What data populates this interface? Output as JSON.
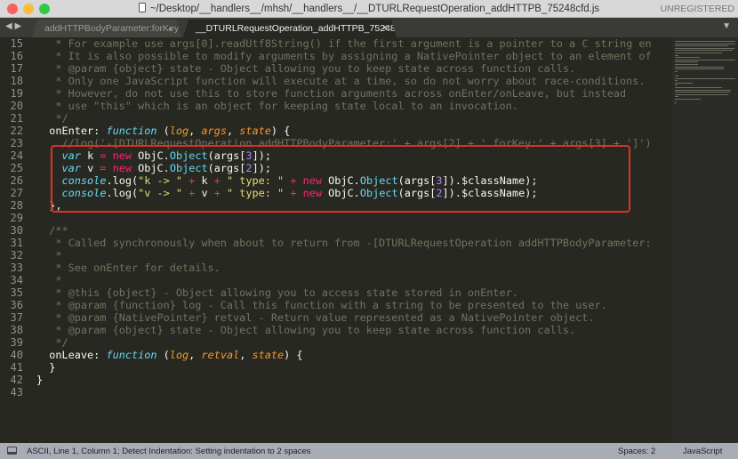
{
  "window": {
    "title": "~/Desktop/__handlers__/mhsh/__handlers__/__DTURLRequestOperation_addHTTPB_75248cfd.js",
    "unregistered": "UNREGISTERED"
  },
  "tabs": [
    {
      "label": "addHTTPBodyParameter:forKey:",
      "marker": "●"
    },
    {
      "label": "__DTURLRequestOperation_addHTTPB_75248cfd.js",
      "marker": "×"
    }
  ],
  "status": {
    "message": "ASCII, Line 1, Column 1; Detect Indentation: Setting indentation to 2 spaces",
    "spaces": "Spaces: 2",
    "syntax": "JavaScript"
  },
  "highlight_color": "#e0301e",
  "lines": [
    {
      "n": "15",
      "t": [
        [
          "c",
          "   * For example use args[0].readUtf8String() if the first argument is a pointer to a C string en"
        ]
      ]
    },
    {
      "n": "16",
      "t": [
        [
          "c",
          "   * It is also possible to modify arguments by assigning a NativePointer object to an element of"
        ]
      ]
    },
    {
      "n": "17",
      "t": [
        [
          "c",
          "   * @param {object} state - Object allowing you to keep state across function calls."
        ]
      ]
    },
    {
      "n": "18",
      "t": [
        [
          "c",
          "   * Only one JavaScript function will execute at a time, so do not worry about race-conditions."
        ]
      ]
    },
    {
      "n": "19",
      "t": [
        [
          "c",
          "   * However, do not use this to store function arguments across onEnter/onLeave, but instead"
        ]
      ]
    },
    {
      "n": "20",
      "t": [
        [
          "c",
          "   * use \"this\" which is an object for keeping state local to an invocation."
        ]
      ]
    },
    {
      "n": "21",
      "t": [
        [
          "c",
          "   */"
        ]
      ]
    },
    {
      "n": "22",
      "t": [
        [
          "d",
          "  onEnter: "
        ],
        [
          "f",
          "function"
        ],
        [
          "d",
          " ("
        ],
        [
          "p",
          "log"
        ],
        [
          "d",
          ", "
        ],
        [
          "p",
          "args"
        ],
        [
          "d",
          ", "
        ],
        [
          "p",
          "state"
        ],
        [
          "d",
          ") {"
        ]
      ]
    },
    {
      "n": "23",
      "t": [
        [
          "c",
          "    //log('-[DTURLRequestOperation addHTTPBodyParameter:' + args[2] + ' forKey:' + args[3] + ']')"
        ]
      ]
    },
    {
      "n": "24",
      "t": [
        [
          "d",
          "    "
        ],
        [
          "f",
          "var"
        ],
        [
          "d",
          " k "
        ],
        [
          "k",
          "="
        ],
        [
          "d",
          " "
        ],
        [
          "k",
          "new"
        ],
        [
          "d",
          " ObjC."
        ],
        [
          "o",
          "Object"
        ],
        [
          "d",
          "(args["
        ],
        [
          "n",
          "3"
        ],
        [
          "d",
          "]);"
        ]
      ]
    },
    {
      "n": "25",
      "t": [
        [
          "d",
          "    "
        ],
        [
          "f",
          "var"
        ],
        [
          "d",
          " v "
        ],
        [
          "k",
          "="
        ],
        [
          "d",
          " "
        ],
        [
          "k",
          "new"
        ],
        [
          "d",
          " ObjC."
        ],
        [
          "o",
          "Object"
        ],
        [
          "d",
          "(args["
        ],
        [
          "n",
          "2"
        ],
        [
          "d",
          "]);"
        ]
      ]
    },
    {
      "n": "26",
      "t": [
        [
          "d",
          "    "
        ],
        [
          "f",
          "console"
        ],
        [
          "d",
          ".log("
        ],
        [
          "s",
          "\"k -> \""
        ],
        [
          "d",
          " "
        ],
        [
          "k",
          "+"
        ],
        [
          "d",
          " k "
        ],
        [
          "k",
          "+"
        ],
        [
          "d",
          " "
        ],
        [
          "s",
          "\" type: \""
        ],
        [
          "d",
          " "
        ],
        [
          "k",
          "+"
        ],
        [
          "d",
          " "
        ],
        [
          "k",
          "new"
        ],
        [
          "d",
          " ObjC."
        ],
        [
          "o",
          "Object"
        ],
        [
          "d",
          "(args["
        ],
        [
          "n",
          "3"
        ],
        [
          "d",
          "]).$className);"
        ]
      ]
    },
    {
      "n": "27",
      "t": [
        [
          "d",
          "    "
        ],
        [
          "f",
          "console"
        ],
        [
          "d",
          ".log("
        ],
        [
          "s",
          "\"v -> \""
        ],
        [
          "d",
          " "
        ],
        [
          "k",
          "+"
        ],
        [
          "d",
          " v "
        ],
        [
          "k",
          "+"
        ],
        [
          "d",
          " "
        ],
        [
          "s",
          "\" type: \""
        ],
        [
          "d",
          " "
        ],
        [
          "k",
          "+"
        ],
        [
          "d",
          " "
        ],
        [
          "k",
          "new"
        ],
        [
          "d",
          " ObjC."
        ],
        [
          "o",
          "Object"
        ],
        [
          "d",
          "(args["
        ],
        [
          "n",
          "2"
        ],
        [
          "d",
          "]).$className);"
        ]
      ]
    },
    {
      "n": "28",
      "t": [
        [
          "d",
          "  },"
        ]
      ]
    },
    {
      "n": "29",
      "t": []
    },
    {
      "n": "30",
      "t": [
        [
          "c",
          "  /**"
        ]
      ]
    },
    {
      "n": "31",
      "t": [
        [
          "c",
          "   * Called synchronously when about to return from -[DTURLRequestOperation addHTTPBodyParameter:"
        ]
      ]
    },
    {
      "n": "32",
      "t": [
        [
          "c",
          "   *"
        ]
      ]
    },
    {
      "n": "33",
      "t": [
        [
          "c",
          "   * See onEnter for details."
        ]
      ]
    },
    {
      "n": "34",
      "t": [
        [
          "c",
          "   *"
        ]
      ]
    },
    {
      "n": "35",
      "t": [
        [
          "c",
          "   * @this {object} - Object allowing you to access state stored in onEnter."
        ]
      ]
    },
    {
      "n": "36",
      "t": [
        [
          "c",
          "   * @param {function} log - Call this function with a string to be presented to the user."
        ]
      ]
    },
    {
      "n": "37",
      "t": [
        [
          "c",
          "   * @param {NativePointer} retval - Return value represented as a NativePointer object."
        ]
      ]
    },
    {
      "n": "38",
      "t": [
        [
          "c",
          "   * @param {object} state - Object allowing you to keep state across function calls."
        ]
      ]
    },
    {
      "n": "39",
      "t": [
        [
          "c",
          "   */"
        ]
      ]
    },
    {
      "n": "40",
      "t": [
        [
          "d",
          "  onLeave: "
        ],
        [
          "f",
          "function"
        ],
        [
          "d",
          " ("
        ],
        [
          "p",
          "log"
        ],
        [
          "d",
          ", "
        ],
        [
          "p",
          "retval"
        ],
        [
          "d",
          ", "
        ],
        [
          "p",
          "state"
        ],
        [
          "d",
          ") {"
        ]
      ]
    },
    {
      "n": "41",
      "t": [
        [
          "d",
          "  }"
        ]
      ]
    },
    {
      "n": "42",
      "t": [
        [
          "d",
          "}"
        ]
      ]
    },
    {
      "n": "43",
      "t": []
    }
  ]
}
